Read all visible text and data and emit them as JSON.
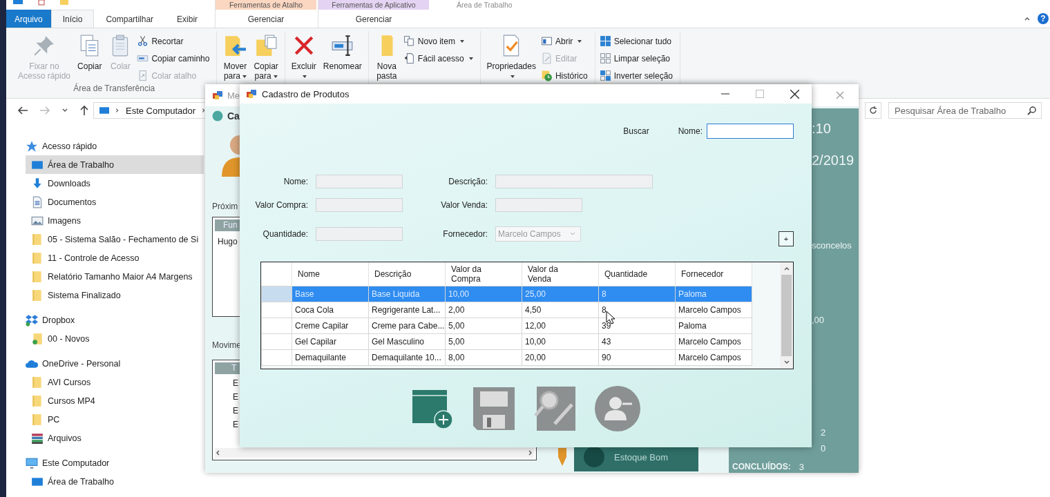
{
  "explorer": {
    "title": "Área de Trabalho",
    "contextual": [
      {
        "label": "Ferramentas de Atalho",
        "color": "#fbd6c0",
        "tab": {
          "label": "Gerenciar",
          "selected": false
        }
      },
      {
        "label": "Ferramentas de Aplicativo",
        "color": "#e4d3f2",
        "tab": {
          "label": "Gerenciar",
          "selected": false
        }
      }
    ],
    "tabs": [
      {
        "label": "Arquivo",
        "kind": "file",
        "selected": false
      },
      {
        "label": "Início",
        "kind": "tab",
        "selected": true
      },
      {
        "label": "Compartilhar",
        "kind": "tab",
        "selected": false
      },
      {
        "label": "Exibir",
        "kind": "tab",
        "selected": false
      }
    ],
    "help": "?",
    "ribbon": [
      {
        "label": "Área de Transferência",
        "items": [
          {
            "kind": "pin",
            "large": true,
            "label": "Fixar no\nAcesso rápido",
            "disabled": true,
            "dropdown": false
          },
          {
            "kind": "copy",
            "large": true,
            "label": "Copiar",
            "disabled": false,
            "dropdown": false
          },
          {
            "kind": "paste",
            "large": true,
            "label": "Colar",
            "disabled": true,
            "dropdown": false
          },
          {
            "kind": "cut",
            "large": false,
            "label": "Recortar",
            "disabled": false,
            "dropdown": false
          },
          {
            "kind": "copy-path",
            "large": false,
            "label": "Copiar caminho",
            "disabled": false,
            "dropdown": false
          },
          {
            "kind": "paste-shortcut",
            "large": false,
            "label": "Colar atalho",
            "disabled": true,
            "dropdown": false
          }
        ]
      },
      {
        "items": [
          {
            "kind": "move-to",
            "large": true,
            "label": "Mover\npara",
            "disabled": false,
            "dropdown": true
          },
          {
            "kind": "copy-to",
            "large": true,
            "label": "Copiar\npara",
            "disabled": false,
            "dropdown": true
          }
        ]
      },
      {
        "items": [
          {
            "kind": "delete",
            "large": true,
            "label": "Excluir",
            "disabled": false,
            "dropdown": true
          },
          {
            "kind": "rename",
            "large": true,
            "label": "Renomear",
            "disabled": false,
            "dropdown": false
          }
        ]
      },
      {
        "items": [
          {
            "kind": "new-folder",
            "large": true,
            "label": "Nova\npasta",
            "disabled": false,
            "dropdown": false
          },
          {
            "kind": "new-item",
            "large": false,
            "label": "Novo item",
            "disabled": false,
            "dropdown": true
          },
          {
            "kind": "easy-access",
            "large": false,
            "label": "Fácil acesso",
            "disabled": false,
            "dropdown": true
          }
        ]
      },
      {
        "items": [
          {
            "kind": "properties",
            "large": true,
            "label": "Propriedades",
            "disabled": false,
            "dropdown": true
          },
          {
            "kind": "open",
            "large": false,
            "label": "Abrir",
            "disabled": false,
            "dropdown": true
          },
          {
            "kind": "edit",
            "large": false,
            "label": "Editar",
            "disabled": true,
            "dropdown": false
          },
          {
            "kind": "history",
            "large": false,
            "label": "Histórico",
            "disabled": false,
            "dropdown": false
          }
        ]
      },
      {
        "items": [
          {
            "kind": "select-all",
            "large": false,
            "label": "Selecionar tudo",
            "disabled": false,
            "dropdown": false
          },
          {
            "kind": "select-none",
            "large": false,
            "label": "Limpar seleção",
            "disabled": false,
            "dropdown": false
          },
          {
            "kind": "invert",
            "large": false,
            "label": "Inverter seleção",
            "disabled": false,
            "dropdown": false
          }
        ]
      }
    ],
    "address": {
      "path": "Este Computador",
      "search_placeholder": "Pesquisar Área de Trabalho"
    },
    "nav": [
      {
        "label": "Acesso rápido",
        "kind": "star",
        "selected": false,
        "children": [
          {
            "label": "Área de Trabalho",
            "kind": "desktop",
            "selected": true
          },
          {
            "label": "Downloads",
            "kind": "download",
            "selected": false
          },
          {
            "label": "Documentos",
            "kind": "document",
            "selected": false
          },
          {
            "label": "Imagens",
            "kind": "pictures",
            "selected": false
          },
          {
            "label": "05 - Sistema Salão - Fechamento de Si",
            "kind": "folder",
            "selected": false
          },
          {
            "label": "11 - Controle de Acesso",
            "kind": "folder",
            "selected": false
          },
          {
            "label": "Relatório Tamanho Maior A4 Margens",
            "kind": "folder",
            "selected": false
          },
          {
            "label": "Sistema Finalizado",
            "kind": "folder",
            "selected": false
          }
        ]
      },
      {
        "label": "Dropbox",
        "kind": "dropbox",
        "selected": false,
        "children": [
          {
            "label": "00 - Novos",
            "kind": "synced-folder",
            "selected": false
          }
        ]
      },
      {
        "label": "OneDrive - Personal",
        "kind": "cloud",
        "selected": false,
        "children": [
          {
            "label": "AVI Cursos",
            "kind": "folder",
            "selected": false
          },
          {
            "label": "Cursos MP4",
            "kind": "folder",
            "selected": false
          },
          {
            "label": "PC",
            "kind": "folder",
            "selected": false
          },
          {
            "label": "Arquivos",
            "kind": "archive",
            "selected": false
          }
        ]
      },
      {
        "label": "Este Computador",
        "kind": "computer",
        "selected": false,
        "children": [
          {
            "label": "Área de Trabalho",
            "kind": "desktop",
            "selected": false
          }
        ]
      }
    ]
  },
  "back_window": {
    "title": "Me",
    "heading": "Ca",
    "next_label": "Próxim",
    "next_list": {
      "header": "Fun",
      "rows": [
        "Hugo"
      ]
    },
    "moves_label": "Movime",
    "moves_list": {
      "header": "T",
      "rows": [
        "E",
        "E",
        "E",
        "E"
      ]
    },
    "card": "Estoque Bom",
    "panel": {
      "time": ":10",
      "date": "2/2019",
      "name": "sconcelos",
      "amount": ",00",
      "stats": [
        {
          "value": "2"
        },
        {
          "value": "0"
        },
        {
          "label": "CONCLUÍDOS:",
          "value": "3"
        }
      ]
    }
  },
  "dialog": {
    "title": "Cadastro de Produtos",
    "search_label": "Buscar",
    "search_field_label": "Nome:",
    "fields": [
      {
        "label": "Nome:",
        "kind": "text",
        "disabled": true
      },
      {
        "label": "Descrição:",
        "kind": "long-text",
        "disabled": true
      },
      {
        "label": "Valor Compra:",
        "kind": "text",
        "disabled": true
      },
      {
        "label": "Valor Venda:",
        "kind": "text",
        "disabled": true
      },
      {
        "label": "Quantidade:",
        "kind": "text",
        "disabled": true
      },
      {
        "label": "Fornecedor:",
        "kind": "combo",
        "value": "Marcelo Campos",
        "disabled": true
      }
    ],
    "add_button": "+",
    "table": {
      "columns": [
        "Nome",
        "Descrição",
        "Valor da\nCompra",
        "Valor da\nVenda",
        "Quantidade",
        "Fornecedor"
      ],
      "rows": [
        {
          "cells": [
            "Base",
            "Base Liquida",
            "10,00",
            "25,00",
            "8",
            "Paloma"
          ],
          "selected": true
        },
        {
          "cells": [
            "Coca Cola",
            "Regrigerante Lat...",
            "2,00",
            "4,50",
            "8",
            "Marcelo Campos"
          ],
          "selected": false
        },
        {
          "cells": [
            "Creme Capilar",
            "Creme para Cabe...",
            "5,00",
            "12,00",
            "39",
            "Paloma"
          ],
          "selected": false
        },
        {
          "cells": [
            "Gel Capilar",
            "Gel Masculino",
            "5,00",
            "10,00",
            "43",
            "Marcelo Campos"
          ],
          "selected": false
        },
        {
          "cells": [
            "Demaquilante",
            "Demaquilante 10...",
            "8,00",
            "20,00",
            "90",
            "Marcelo Campos"
          ],
          "selected": false
        }
      ]
    }
  }
}
